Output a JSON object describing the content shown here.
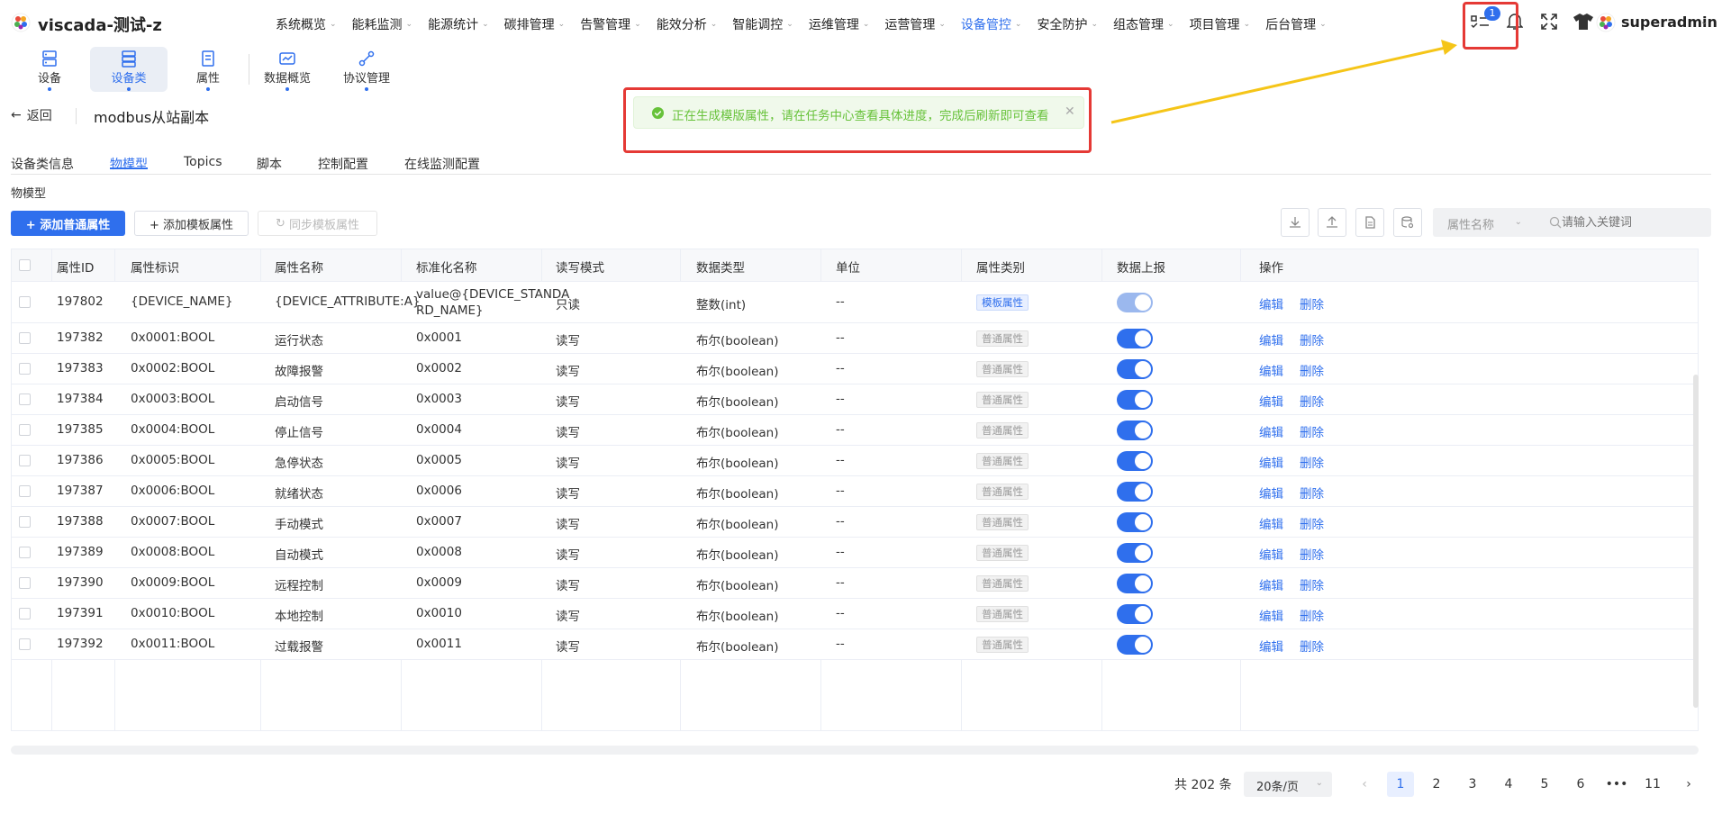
{
  "app": {
    "title": "viscada-测试-z"
  },
  "nav": [
    "系统概览",
    "能耗监测",
    "能源统计",
    "碳排管理",
    "告警管理",
    "能效分析",
    "智能调控",
    "运维管理",
    "运营管理",
    "设备管控",
    "安全防护",
    "组态管理",
    "项目管理",
    "后台管理"
  ],
  "nav_active_index": 9,
  "top_icons": {
    "task_badge": "1"
  },
  "user": {
    "name": "superadmin"
  },
  "subnav": [
    "设备",
    "设备类",
    "属性",
    "数据概览",
    "协议管理"
  ],
  "header": {
    "back_label": "返回",
    "title": "modbus从站副本"
  },
  "tabs": [
    "设备类信息",
    "物模型",
    "Topics",
    "脚本",
    "控制配置",
    "在线监测配置"
  ],
  "section_label": "物模型",
  "toolbar": {
    "add_normal": "+ 添加普通属性",
    "add_template": "+ 添加模板属性",
    "sync_template": "同步模板属性",
    "filter_select": "属性名称",
    "search_placeholder": "请输入关键词"
  },
  "table": {
    "columns": [
      "属性ID",
      "属性标识",
      "属性名称",
      "标准化名称",
      "读写模式",
      "数据类型",
      "单位",
      "属性类别",
      "数据上报",
      "操作"
    ],
    "rows": [
      [
        "197802",
        "{DEVICE_NAME}",
        "{DEVICE_ATTRIBUTE:A}",
        "value@{DEVICE_STANDA",
        "只读",
        "整数(int)",
        "--",
        "模板属性",
        "RD_NAME}"
      ],
      [
        "197382",
        "0x0001:BOOL",
        "运行状态",
        "0x0001",
        "读写",
        "布尔(boolean)",
        "--",
        "普通属性",
        ""
      ],
      [
        "197383",
        "0x0002:BOOL",
        "故障报警",
        "0x0002",
        "读写",
        "布尔(boolean)",
        "--",
        "普通属性",
        ""
      ],
      [
        "197384",
        "0x0003:BOOL",
        "启动信号",
        "0x0003",
        "读写",
        "布尔(boolean)",
        "--",
        "普通属性",
        ""
      ],
      [
        "197385",
        "0x0004:BOOL",
        "停止信号",
        "0x0004",
        "读写",
        "布尔(boolean)",
        "--",
        "普通属性",
        ""
      ],
      [
        "197386",
        "0x0005:BOOL",
        "急停状态",
        "0x0005",
        "读写",
        "布尔(boolean)",
        "--",
        "普通属性",
        ""
      ],
      [
        "197387",
        "0x0006:BOOL",
        "就绪状态",
        "0x0006",
        "读写",
        "布尔(boolean)",
        "--",
        "普通属性",
        ""
      ],
      [
        "197388",
        "0x0007:BOOL",
        "手动模式",
        "0x0007",
        "读写",
        "布尔(boolean)",
        "--",
        "普通属性",
        ""
      ],
      [
        "197389",
        "0x0008:BOOL",
        "自动模式",
        "0x0008",
        "读写",
        "布尔(boolean)",
        "--",
        "普通属性",
        ""
      ],
      [
        "197390",
        "0x0009:BOOL",
        "远程控制",
        "0x0009",
        "读写",
        "布尔(boolean)",
        "--",
        "普通属性",
        ""
      ],
      [
        "197391",
        "0x0010:BOOL",
        "本地控制",
        "0x0010",
        "读写",
        "布尔(boolean)",
        "--",
        "普通属性",
        ""
      ],
      [
        "197392",
        "0x0011:BOOL",
        "过载报警",
        "0x0011",
        "读写",
        "布尔(boolean)",
        "--",
        "普通属性",
        ""
      ]
    ],
    "actions": {
      "edit": "编辑",
      "delete": "删除"
    }
  },
  "pagination": {
    "total": "共 202 条",
    "page_size": "20条/页",
    "pages": [
      "1",
      "2",
      "3",
      "4",
      "5",
      "6",
      "•••",
      "11"
    ],
    "current": "1"
  },
  "toast": {
    "message": "正在生成模版属性，请在任务中心查看具体进度，完成后刷新即可查看"
  },
  "colors": {
    "primary": "#2f6fed",
    "success": "#67c23a",
    "highlight": "#e53935",
    "arrow": "#f5c518"
  }
}
